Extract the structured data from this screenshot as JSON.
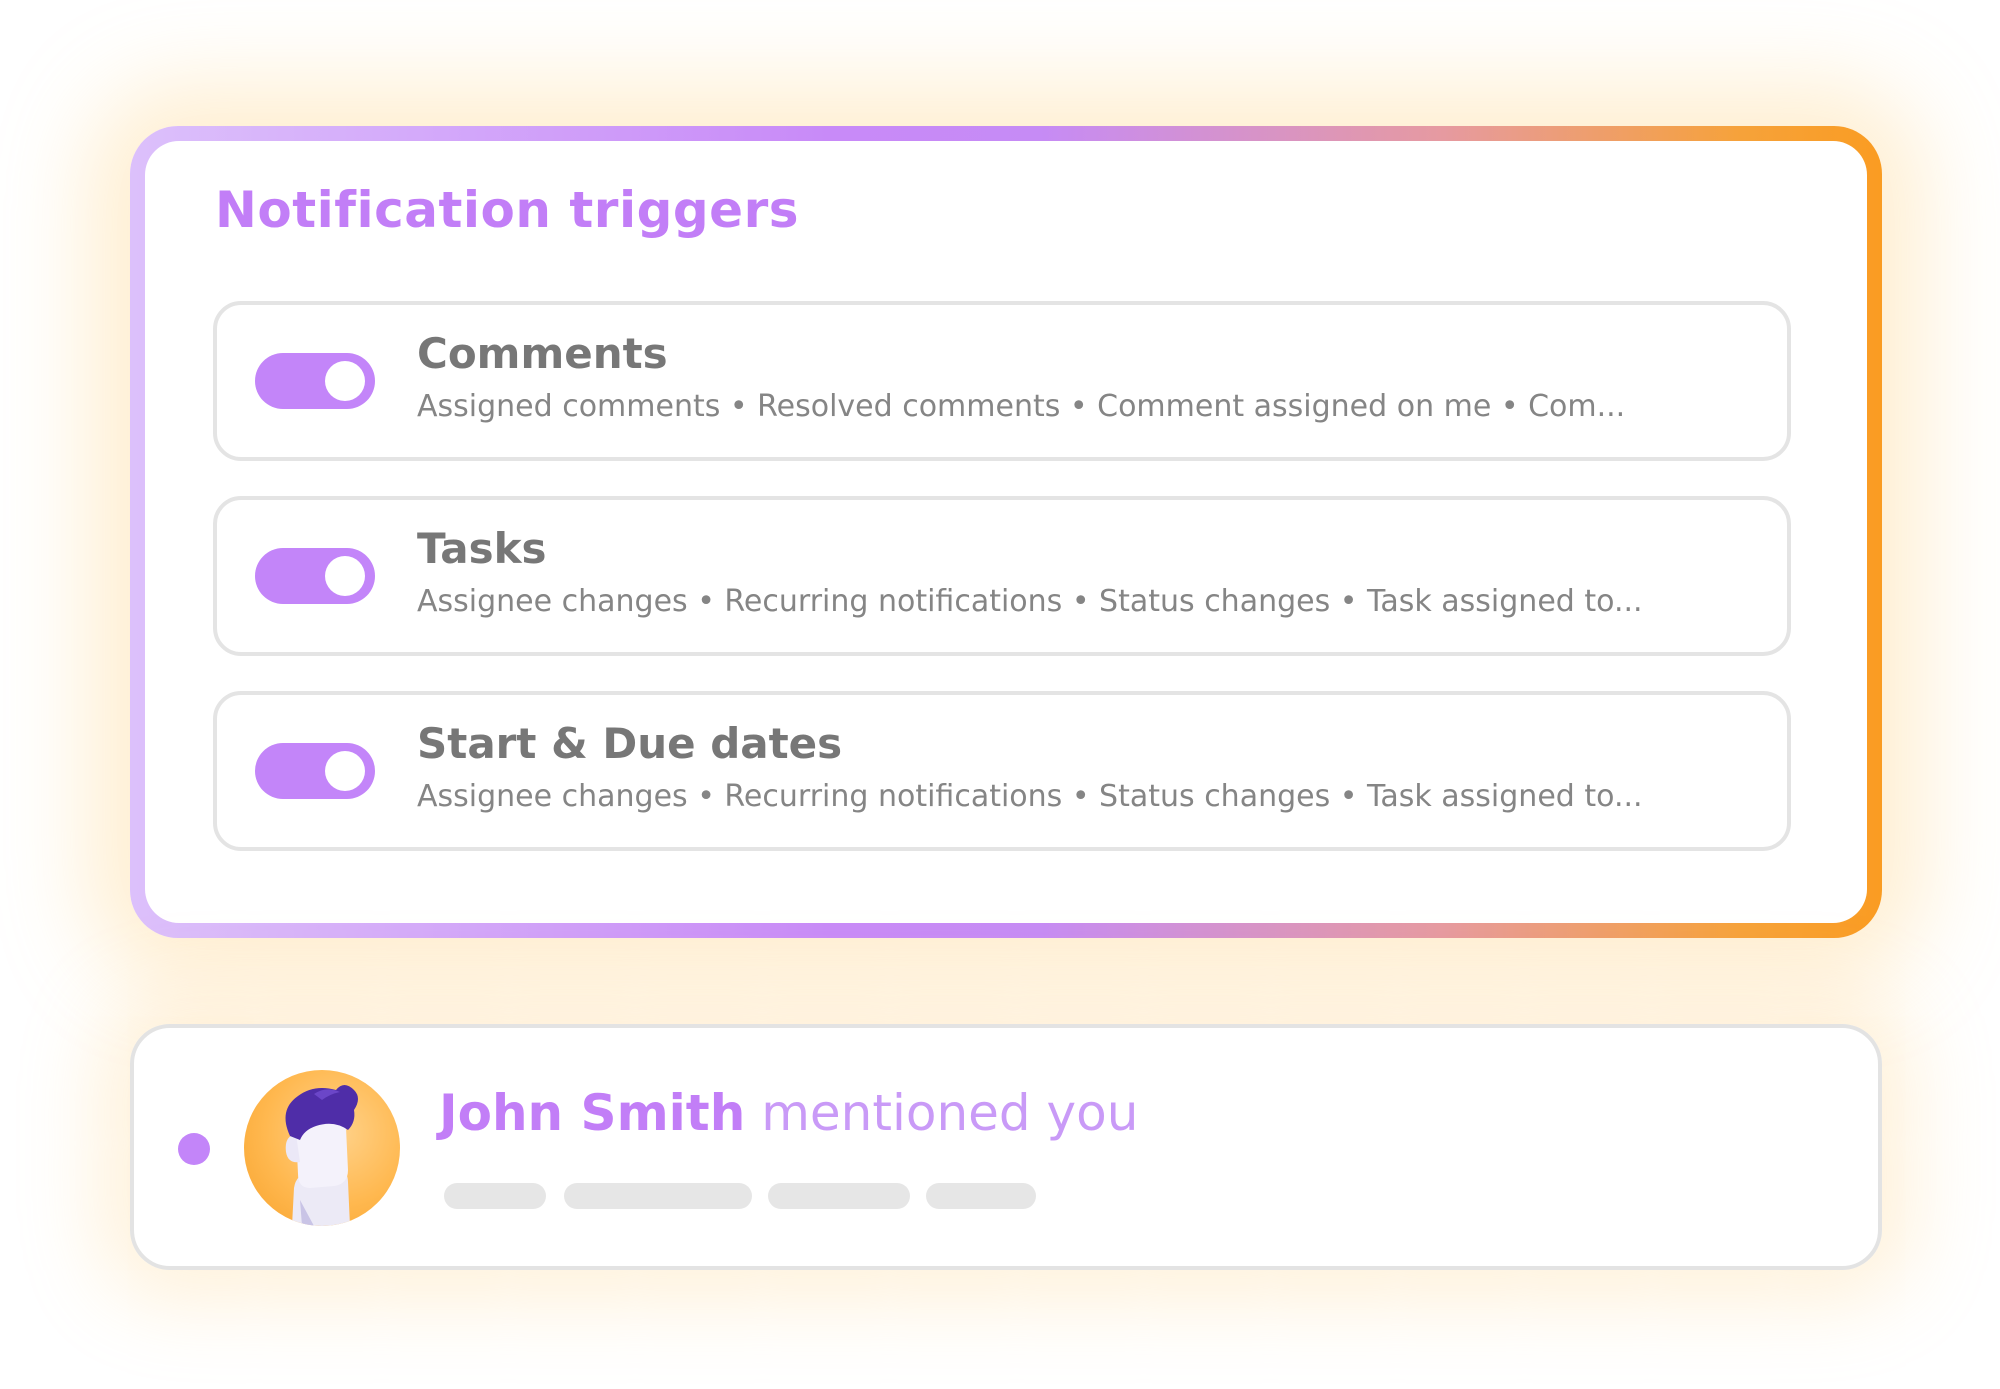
{
  "triggers": {
    "title": "Notification triggers",
    "items": [
      {
        "title": "Comments",
        "description": "Assigned comments • Resolved comments • Comment assigned on me • Com...",
        "enabled": true
      },
      {
        "title": "Tasks",
        "description": "Assignee changes • Recurring notifications • Status changes • Task assigned to...",
        "enabled": true
      },
      {
        "title": "Start & Due dates",
        "description": "Assignee changes • Recurring notifications • Status changes • Task assigned to...",
        "enabled": true
      }
    ]
  },
  "notification": {
    "name": "John Smith",
    "action": "mentioned you",
    "unread": true
  },
  "colors": {
    "accent": "#c385f9",
    "gradient_start": "#dcc0fb",
    "gradient_end": "#fa9c22",
    "text_gray": "#777777"
  }
}
